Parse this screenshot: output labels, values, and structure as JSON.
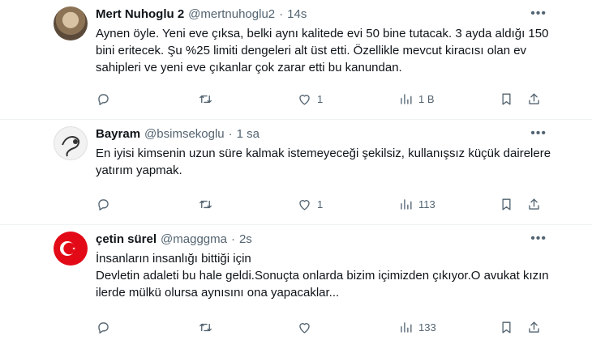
{
  "tweets": [
    {
      "display_name": "Mert Nuhoglu 2",
      "handle": "@mertnuhoglu2",
      "separator": "·",
      "time": "14s",
      "text": "Aynen öyle. Yeni eve çıksa, belki aynı kalitede evi 50 bine tutacak. 3 ayda aldığı 150 bini eritecek. Şu %25 limiti dengeleri alt üst etti. Özellikle mevcut kiracısı olan ev sahipleri ve yeni eve çıkanlar çok zarar etti bu kanundan.",
      "likes": "1",
      "views": "1 B"
    },
    {
      "display_name": "Bayram",
      "handle": "@bsimsekoglu",
      "separator": "·",
      "time": "1 sa",
      "text": "En iyisi kimsenin uzun süre kalmak istemeyeceği şekilsiz, kullanışsız küçük dairelere yatırım yapmak.",
      "likes": "1",
      "views": "113"
    },
    {
      "display_name": "çetin sürel",
      "handle": "@magggma",
      "separator": "·",
      "time": "2s",
      "text": "İnsanların insanlığı bittiği için\nDevletin adaleti bu hale geldi.Sonuçta onlarda bizim içimizden çıkıyor.O avukat kızın ilerde mülkü olursa aynısını ona yapacaklar...",
      "likes": "",
      "views": "133"
    }
  ],
  "icons": {
    "reply": "reply-icon",
    "retweet": "retweet-icon",
    "like": "heart-icon",
    "views": "views-icon",
    "bookmark": "bookmark-icon",
    "share": "share-icon",
    "more": "more-icon"
  },
  "colors": {
    "text_primary": "#0f1419",
    "text_secondary": "#536471",
    "divider": "#eff3f4"
  }
}
